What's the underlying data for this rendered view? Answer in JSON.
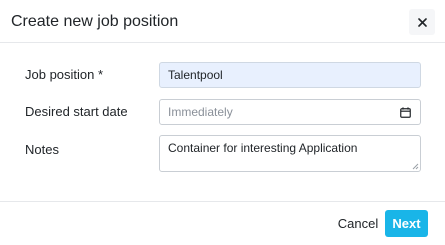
{
  "modal": {
    "title": "Create new job position",
    "close_icon": "close-icon"
  },
  "form": {
    "job_position": {
      "label": "Job position *",
      "value": "Talentpool"
    },
    "start_date": {
      "label": "Desired start date",
      "placeholder": "Immediately",
      "icon": "calendar-icon"
    },
    "notes": {
      "label": "Notes",
      "value": "Container for interesting Application"
    }
  },
  "footer": {
    "cancel_label": "Cancel",
    "next_label": "Next"
  },
  "colors": {
    "accent": "#19b5e8",
    "autofill_bg": "#e8f0fe",
    "border": "#c9ced4"
  }
}
